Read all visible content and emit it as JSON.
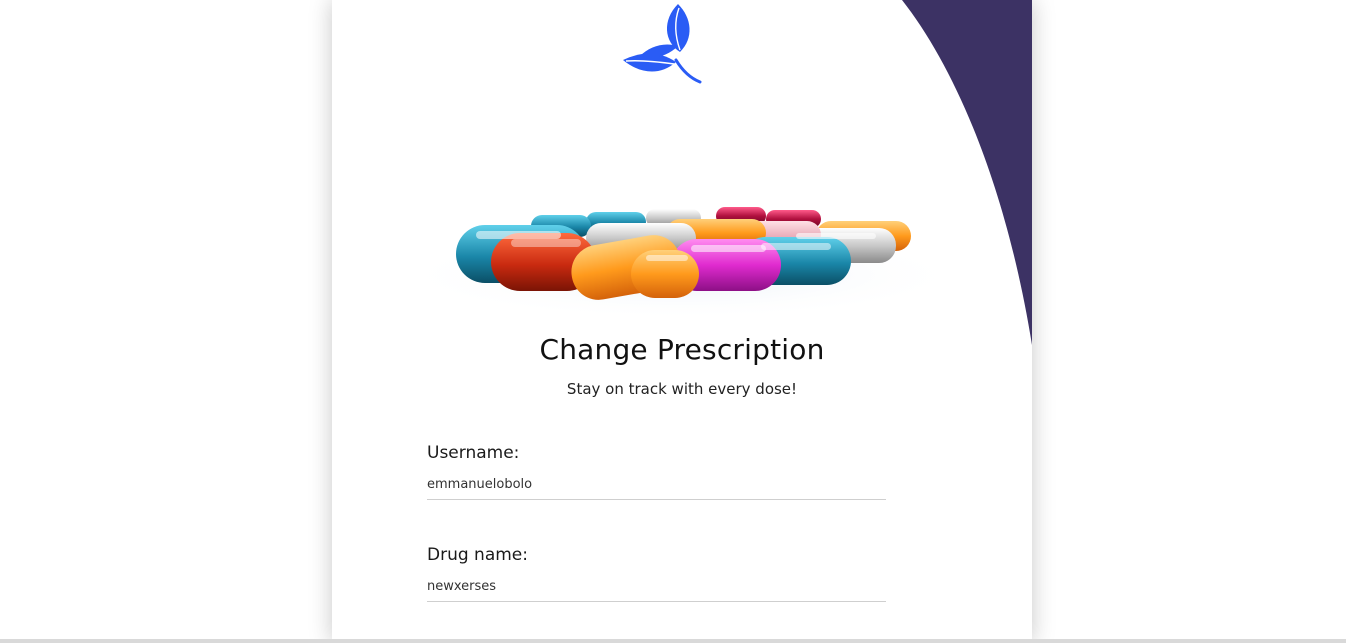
{
  "form": {
    "title": "Change Prescription",
    "subtitle": "Stay on track with every dose!",
    "fields": [
      {
        "label": "Username:",
        "value": "emmanuelobolo"
      },
      {
        "label": "Drug name:",
        "value": "newxerses"
      }
    ]
  },
  "icons": {
    "logo": "leaf-logo-icon",
    "hero": "capsule-pills-image"
  },
  "colors": {
    "accent": "#2a5cf5",
    "corner_arc": "#3c3264",
    "background": "#ffffff"
  }
}
